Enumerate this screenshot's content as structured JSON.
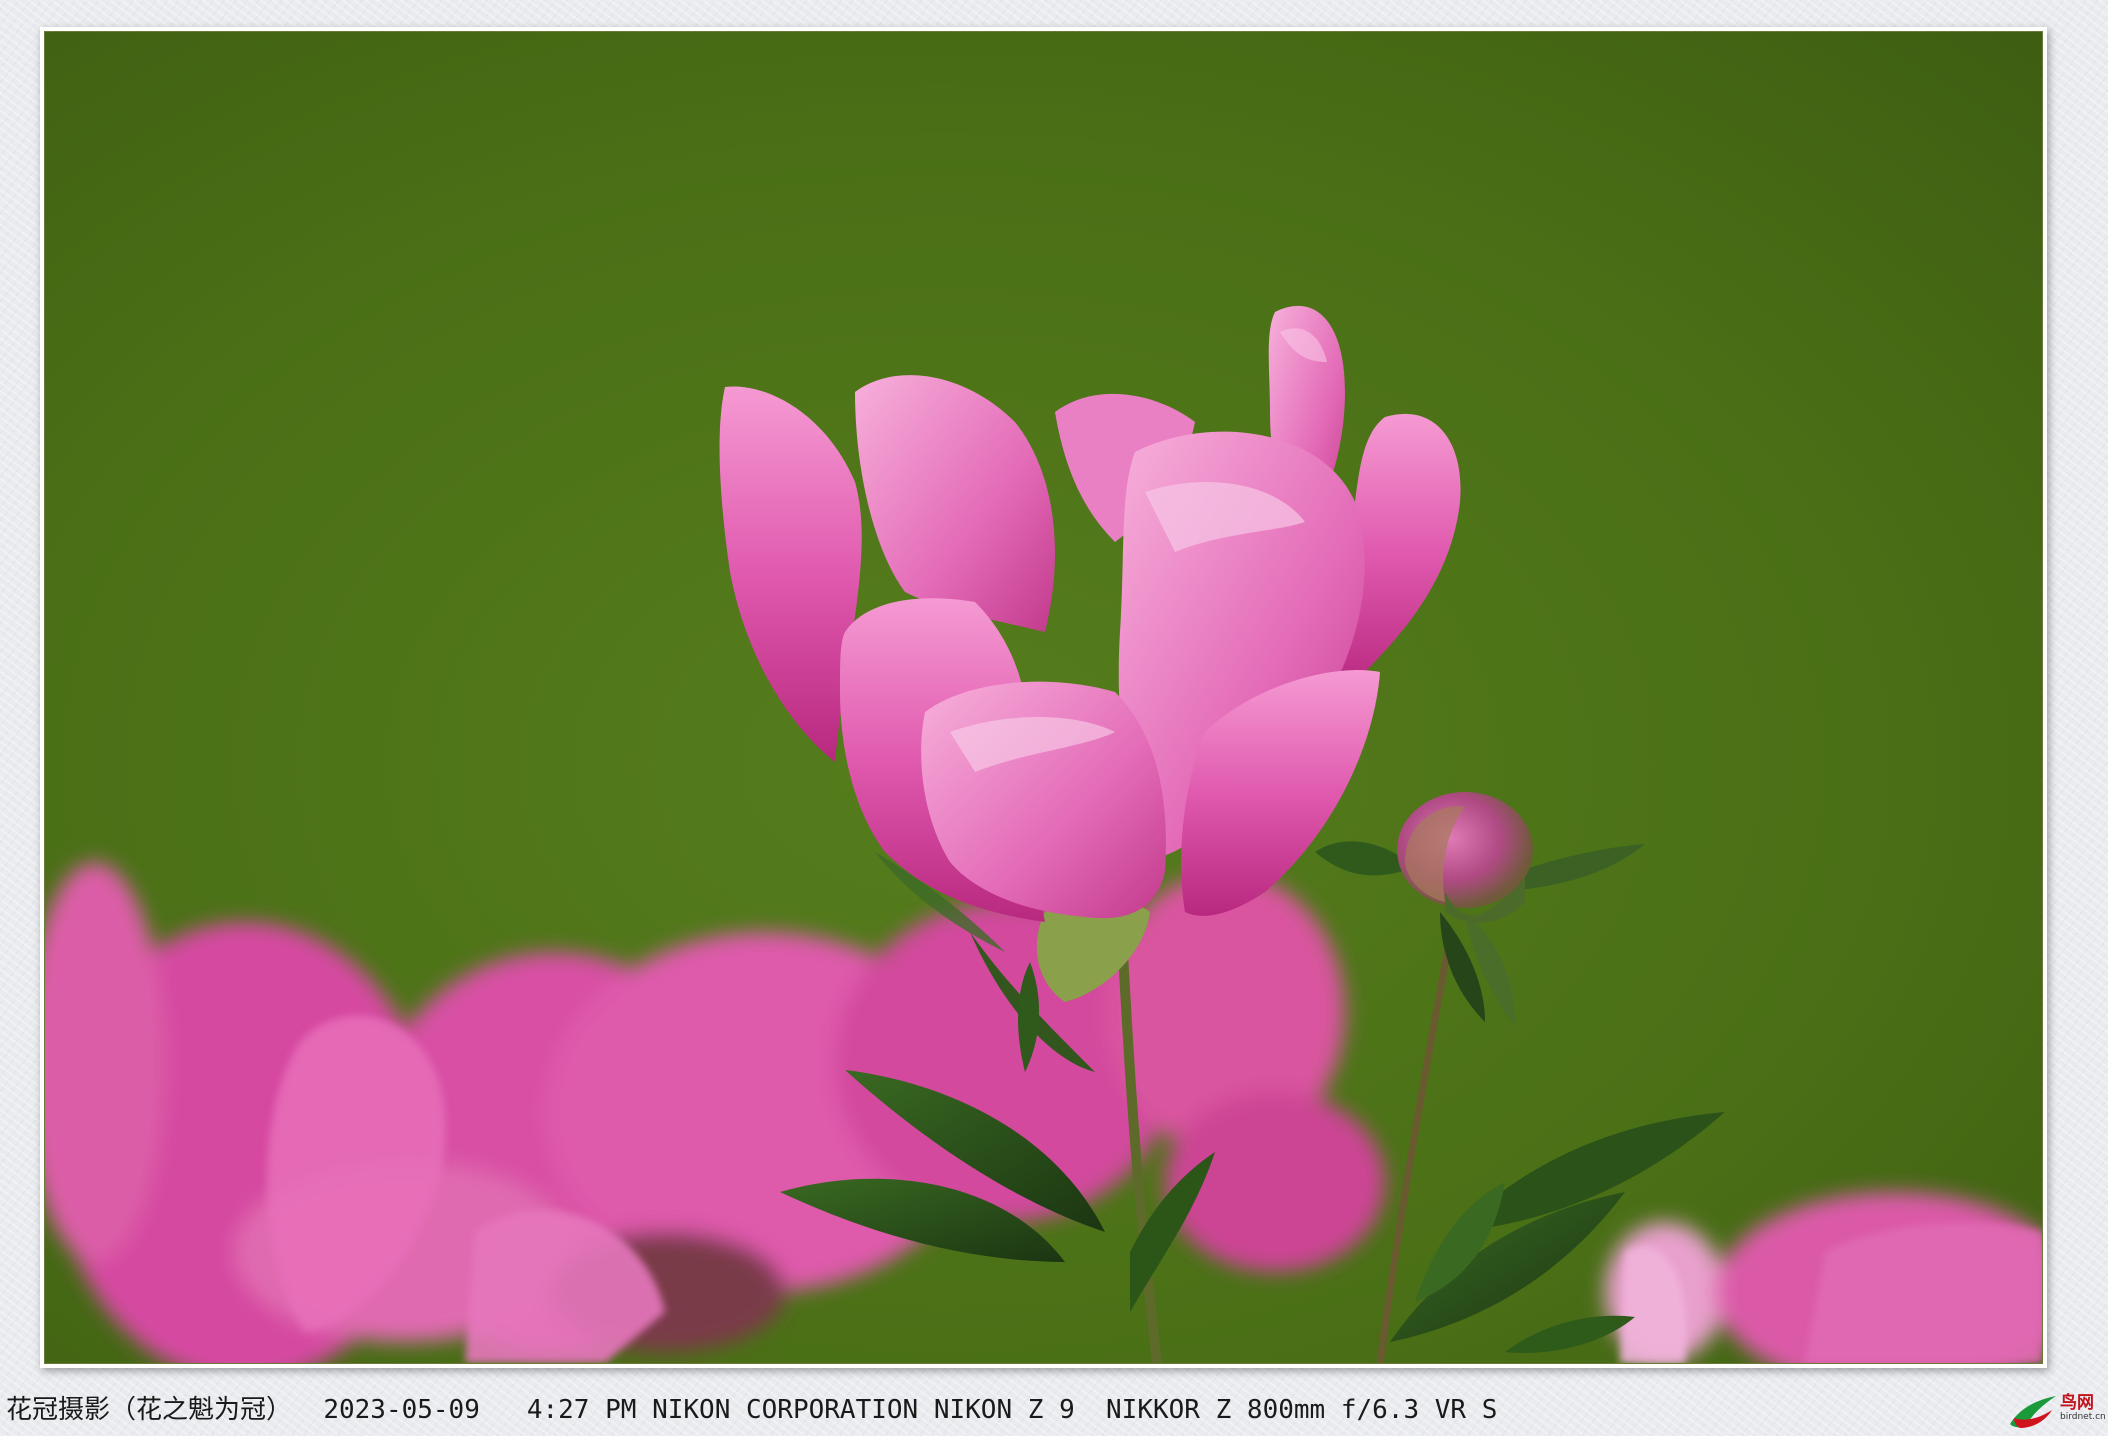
{
  "caption": {
    "title": "花冠摄影（花之魁为冠）",
    "date": "2023-05-09",
    "time": "4:27 PM",
    "camera": "NIKON CORPORATION NIKON Z 9",
    "lens": "NIKKOR Z 800mm f/6.3 VR S"
  },
  "logo": {
    "name": "鸟网",
    "sub": "birdnet.cn"
  },
  "colors": {
    "background_green": "#4a6f16",
    "petal_pink": "#d9469d",
    "leaf_green": "#24461a"
  },
  "photo": {
    "subject": "pink-peony-flower"
  }
}
